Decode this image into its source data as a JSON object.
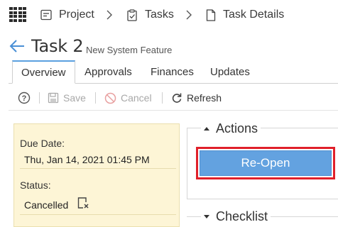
{
  "breadcrumb": {
    "items": [
      {
        "label": "Project",
        "icon": "project-icon"
      },
      {
        "label": "Tasks",
        "icon": "clipboard-check-icon"
      },
      {
        "label": "Task Details",
        "icon": "document-icon"
      }
    ]
  },
  "header": {
    "title": "Task 2",
    "subtitle": "New System Feature"
  },
  "tabs": [
    {
      "label": "Overview",
      "active": true
    },
    {
      "label": "Approvals",
      "active": false
    },
    {
      "label": "Finances",
      "active": false
    },
    {
      "label": "Updates",
      "active": false
    }
  ],
  "toolbar": {
    "save_label": "Save",
    "cancel_label": "Cancel",
    "refresh_label": "Refresh"
  },
  "info": {
    "due_date_label": "Due Date:",
    "due_date_value": "Thu, Jan 14, 2021 01:45 PM",
    "status_label": "Status:",
    "status_value": "Cancelled"
  },
  "actions": {
    "title": "Actions",
    "reopen_label": "Re-Open"
  },
  "checklist": {
    "title": "Checklist"
  },
  "colors": {
    "accent": "#63a2e0",
    "highlight": "#e0202a",
    "info_panel_bg": "#fdf5d6",
    "cancel_icon": "#e57373"
  }
}
